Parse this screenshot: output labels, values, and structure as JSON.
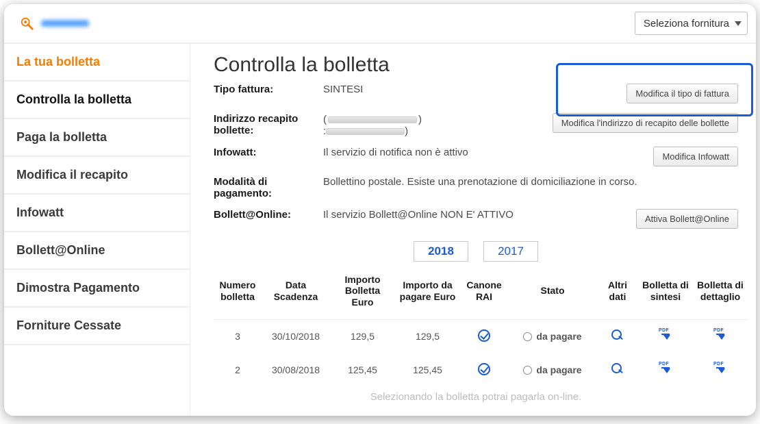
{
  "topbar": {
    "supply_select_label": "Seleziona fornitura"
  },
  "sidebar": {
    "items": [
      {
        "label": "La tua bolletta",
        "active": true
      },
      {
        "label": "Controlla la bolletta",
        "current": true
      },
      {
        "label": "Paga la bolletta"
      },
      {
        "label": "Modifica il recapito"
      },
      {
        "label": "Infowatt"
      },
      {
        "label": "Bollett@Online"
      },
      {
        "label": "Dimostra Pagamento"
      },
      {
        "label": "Forniture Cessate"
      }
    ]
  },
  "main": {
    "title": "Controlla la bolletta",
    "rows": {
      "tipo_fattura": {
        "label": "Tipo fattura:",
        "value": "SINTESI"
      },
      "indirizzo": {
        "label": "Indirizzo recapito bollette:",
        "value_redacted": true
      },
      "infowatt": {
        "label": "Infowatt:",
        "value": "Il servizio di notifica non è attivo"
      },
      "pagamento": {
        "label": "Modalità di pagamento:",
        "value": "Bollettino postale. Esiste una prenotazione di domiciliazione in corso."
      },
      "online": {
        "label": "Bollett@Online:",
        "value": "Il servizio Bollett@Online NON E' ATTIVO"
      }
    },
    "buttons": {
      "modifica_tipo": "Modifica il tipo di fattura",
      "modifica_indirizzo": "Modifica l'indirizzo di recapito delle bollette",
      "modifica_infowatt": "Modifica Infowatt",
      "attiva_online": "Attiva Bollett@Online"
    },
    "years": {
      "list": [
        "2018",
        "2017"
      ],
      "active": "2018"
    },
    "table": {
      "headers": {
        "numero": "Numero bolletta",
        "scadenza": "Data Scadenza",
        "importo": "Importo Bolletta Euro",
        "da_pagare": "Importo da pagare Euro",
        "canone": "Canone RAI",
        "stato": "Stato",
        "altri": "Altri dati",
        "sintesi": "Bolletta di sintesi",
        "dettaglio": "Bolletta di dettaglio"
      },
      "rows": [
        {
          "numero": "3",
          "scadenza": "30/10/2018",
          "importo": "129,5",
          "da_pagare": "129,5",
          "stato": "da pagare"
        },
        {
          "numero": "2",
          "scadenza": "30/08/2018",
          "importo": "125,45",
          "da_pagare": "125,45",
          "stato": "da pagare"
        }
      ]
    },
    "footer_hint": "Selezionando la bolletta potrai pagarla on-line."
  },
  "chart_data": {
    "type": "table",
    "title": "Controlla la bolletta — 2018",
    "columns": [
      "Numero bolletta",
      "Data Scadenza",
      "Importo Bolletta Euro",
      "Importo da pagare Euro",
      "Canone RAI",
      "Stato"
    ],
    "rows": [
      [
        "3",
        "30/10/2018",
        129.5,
        129.5,
        true,
        "da pagare"
      ],
      [
        "2",
        "30/08/2018",
        125.45,
        125.45,
        true,
        "da pagare"
      ]
    ]
  }
}
